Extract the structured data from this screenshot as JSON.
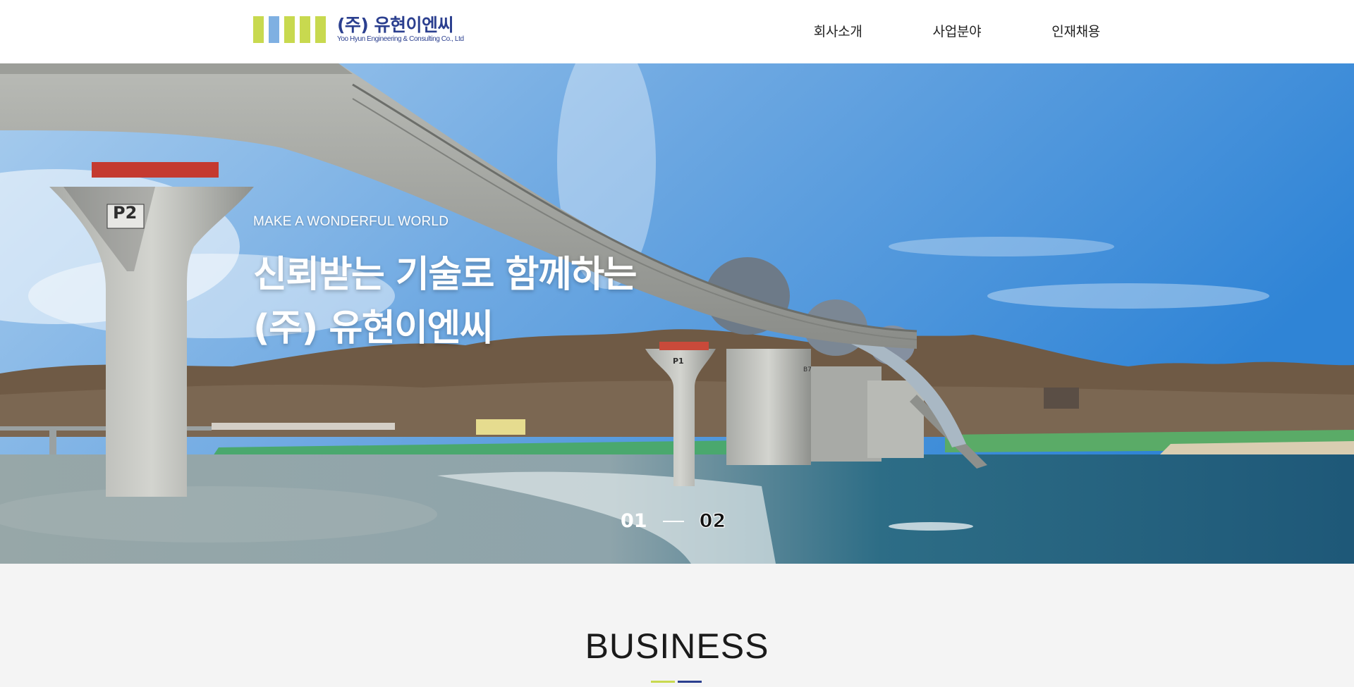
{
  "header": {
    "logo": {
      "korean": "(주) 유현이엔씨",
      "english": "Yoo Hyun Engineering & Consulting Co., Ltd",
      "bar_colors": [
        "#c8d94f",
        "#7fb0e2",
        "#c8d94f",
        "#c8d94f",
        "#c8d94f"
      ]
    },
    "nav": [
      "회사소개",
      "사업분야",
      "인재채용"
    ]
  },
  "hero": {
    "eyebrow": "MAKE A WONDERFUL WORLD",
    "title_line1": "신뢰받는 기술로 함께하는",
    "title_line2": "(주) 유현이엔씨",
    "pier_label_main": "P2",
    "pier_label_small": "P1",
    "pier_label_gate": "B7",
    "pager": {
      "current": "01",
      "next": "02"
    }
  },
  "business": {
    "title": "BUSINESS",
    "accent_colors": [
      "#c8d94f",
      "#2b3f8f"
    ]
  }
}
